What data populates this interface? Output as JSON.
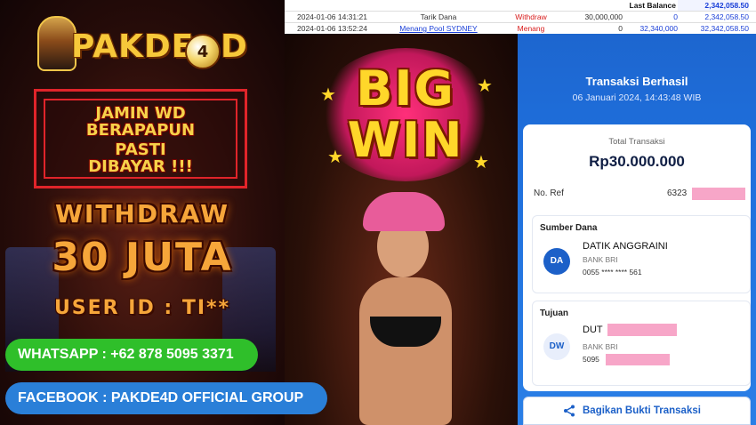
{
  "brand": {
    "name": "PAKDE",
    "ball_digit": "4",
    "suffix": "D"
  },
  "banner": {
    "lines": [
      "JAMIN WD",
      "BERAPAPUN",
      "PASTI",
      "DIBAYAR !!!"
    ]
  },
  "headline": {
    "line1": "WITHDRAW",
    "line2": "30 JUTA"
  },
  "user": {
    "label": "USER ID : TI**"
  },
  "contacts": {
    "whatsapp": "WHATSAPP : +62 878 5095 3371",
    "facebook": "FACEBOOK : PAKDE4D OFFICIAL GROUP"
  },
  "bigwin": {
    "line1": "BIG",
    "line2": "WIN"
  },
  "statement": {
    "last_balance_label": "Last Balance",
    "last_balance": "2,342,058.50",
    "rows": [
      {
        "date": "2024-01-06 14:31:21",
        "desc": "Tarik Dana",
        "status": "Withdraw",
        "debit": "30,000,000",
        "credit": "0",
        "balance": "2,342,058.50"
      },
      {
        "date": "2024-01-06 13:52:24",
        "desc": "Menang Pool SYDNEY",
        "status": "Menang",
        "debit": "0",
        "credit": "32,340,000",
        "balance": "32,342,058.50"
      }
    ]
  },
  "receipt": {
    "title": "Transaksi Berhasil",
    "datetime": "06 Januari 2024, 14:43:48 WIB",
    "total_label": "Total Transaksi",
    "total_value": "Rp30.000.000",
    "ref_label": "No. Ref",
    "ref_prefix": "6323",
    "source": {
      "label": "Sumber Dana",
      "initials": "DA",
      "name": "DATIK ANGGRAINI",
      "bank": "BANK BRI",
      "account": "0055 **** **** 561"
    },
    "dest": {
      "label": "Tujuan",
      "initials": "DW",
      "name_prefix": "DUT",
      "bank": "BANK BRI",
      "account_prefix": "5095"
    },
    "share_label": "Bagikan Bukti Transaksi"
  },
  "colors": {
    "whatsapp": "#2fbf2a",
    "facebook": "#2a7fd8",
    "gold": "#f6a63a",
    "red_frame": "#e0242a",
    "bri_blue": "#1c60c8",
    "mask_pink": "#f7a6c8"
  },
  "icons": {
    "share": "share-icon"
  }
}
